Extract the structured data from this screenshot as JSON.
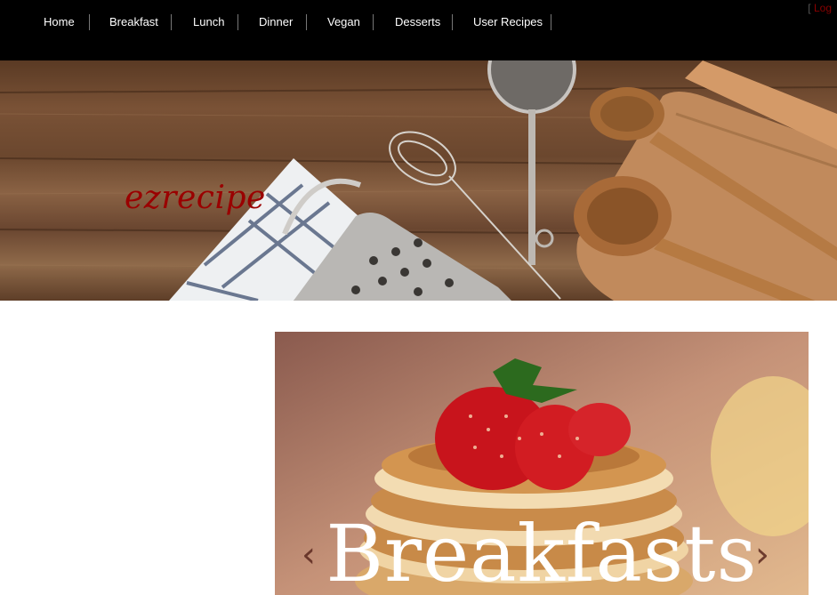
{
  "nav": {
    "items": [
      {
        "label": "Home"
      },
      {
        "label": "Breakfast"
      },
      {
        "label": "Lunch"
      },
      {
        "label": "Dinner"
      },
      {
        "label": "Vegan"
      },
      {
        "label": "Desserts"
      },
      {
        "label": "User Recipes"
      }
    ]
  },
  "header": {
    "login_bracket": "[",
    "login_label": "Log",
    "site_name": "ezrecipe"
  },
  "slider": {
    "title": "Breakfasts",
    "prev_icon": "‹",
    "next_icon": "›"
  },
  "colors": {
    "topbar": "#000000",
    "logo": "#9a0000",
    "login": "#8a0000"
  }
}
